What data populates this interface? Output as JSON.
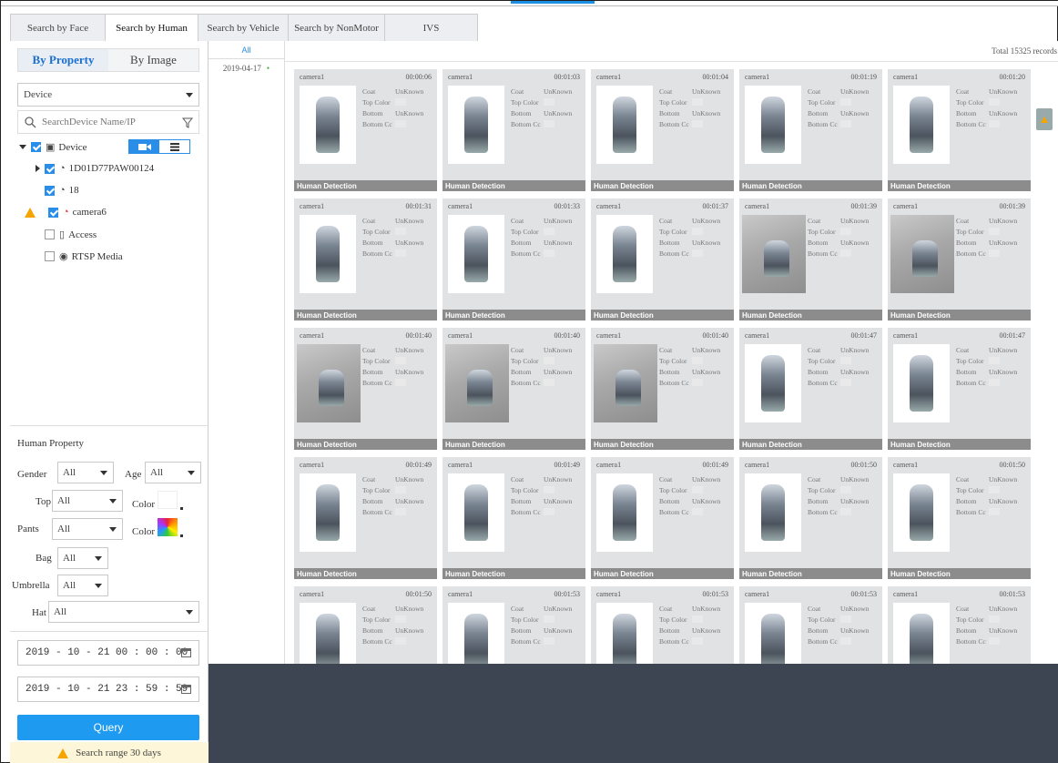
{
  "tabs": [
    {
      "label": "Search by Face",
      "active": false
    },
    {
      "label": "Search by Human",
      "active": true
    },
    {
      "label": "Search by Vehicle",
      "active": false
    },
    {
      "label": "Search by NonMotor",
      "active": false
    },
    {
      "label": "IVS",
      "active": false
    }
  ],
  "sidebar": {
    "mode": {
      "by_property": "By Property",
      "by_image": "By Image"
    },
    "source_select": "Device",
    "search_placeholder": "SearchDevice Name/IP",
    "tree": {
      "root": "Device",
      "channel1": "1D01D77PAW00124",
      "channel2": "18",
      "channel3": "camera6",
      "access": "Access",
      "rtsp": "RTSP Media"
    },
    "human_property": {
      "title": "Human Property",
      "gender_label": "Gender",
      "gender_value": "All",
      "age_label": "Age",
      "age_value": "All",
      "top_label": "Top",
      "top_value": "All",
      "top_color_label": "Color",
      "pants_label": "Pants",
      "pants_value": "All",
      "pants_color_label": "Color",
      "bag_label": "Bag",
      "bag_value": "All",
      "umbrella_label": "Umbrella",
      "umbrella_value": "All",
      "hat_label": "Hat",
      "hat_value": "All"
    },
    "start_time": "2019 - 10 - 21  00 : 00 : 00",
    "end_time": "2019 - 10 - 21  23 : 59 : 59",
    "query_label": "Query",
    "range_notice": "Search range 30 days"
  },
  "dates": {
    "all": "All",
    "items": [
      "2019-04-17"
    ]
  },
  "results": {
    "total": "Total 15325 records",
    "attr_labels": {
      "coat": "Coat",
      "top_color": "Top Color",
      "bottom": "Bottom",
      "bottom_color": "Bottom Cc"
    },
    "unknown": "UnKnown",
    "footer": "Human Detection",
    "cards": [
      {
        "camera": "camera1",
        "time": "00:00:06",
        "wide": false
      },
      {
        "camera": "camera1",
        "time": "00:01:03",
        "wide": false
      },
      {
        "camera": "camera1",
        "time": "00:01:04",
        "wide": false
      },
      {
        "camera": "camera1",
        "time": "00:01:19",
        "wide": false
      },
      {
        "camera": "camera1",
        "time": "00:01:20",
        "wide": false
      },
      {
        "camera": "camera1",
        "time": "00:01:31",
        "wide": false
      },
      {
        "camera": "camera1",
        "time": "00:01:33",
        "wide": false
      },
      {
        "camera": "camera1",
        "time": "00:01:37",
        "wide": false
      },
      {
        "camera": "camera1",
        "time": "00:01:39",
        "wide": true
      },
      {
        "camera": "camera1",
        "time": "00:01:39",
        "wide": true
      },
      {
        "camera": "camera1",
        "time": "00:01:40",
        "wide": true
      },
      {
        "camera": "camera1",
        "time": "00:01:40",
        "wide": true
      },
      {
        "camera": "camera1",
        "time": "00:01:40",
        "wide": true
      },
      {
        "camera": "camera1",
        "time": "00:01:47",
        "wide": false
      },
      {
        "camera": "camera1",
        "time": "00:01:47",
        "wide": false
      },
      {
        "camera": "camera1",
        "time": "00:01:49",
        "wide": false
      },
      {
        "camera": "camera1",
        "time": "00:01:49",
        "wide": false
      },
      {
        "camera": "camera1",
        "time": "00:01:49",
        "wide": false
      },
      {
        "camera": "camera1",
        "time": "00:01:50",
        "wide": false
      },
      {
        "camera": "camera1",
        "time": "00:01:50",
        "wide": false
      },
      {
        "camera": "camera1",
        "time": "00:01:50",
        "wide": false
      },
      {
        "camera": "camera1",
        "time": "00:01:53",
        "wide": false
      },
      {
        "camera": "camera1",
        "time": "00:01:53",
        "wide": false
      },
      {
        "camera": "camera1",
        "time": "00:01:53",
        "wide": false
      },
      {
        "camera": "camera1",
        "time": "00:01:53",
        "wide": false
      }
    ]
  },
  "colors": {
    "accent": "#1e9af0",
    "warning": "#f5a400",
    "card_bg": "#e1e2e4",
    "footer_bg": "#8c8c8c",
    "lower_panel": "#3d4452"
  }
}
